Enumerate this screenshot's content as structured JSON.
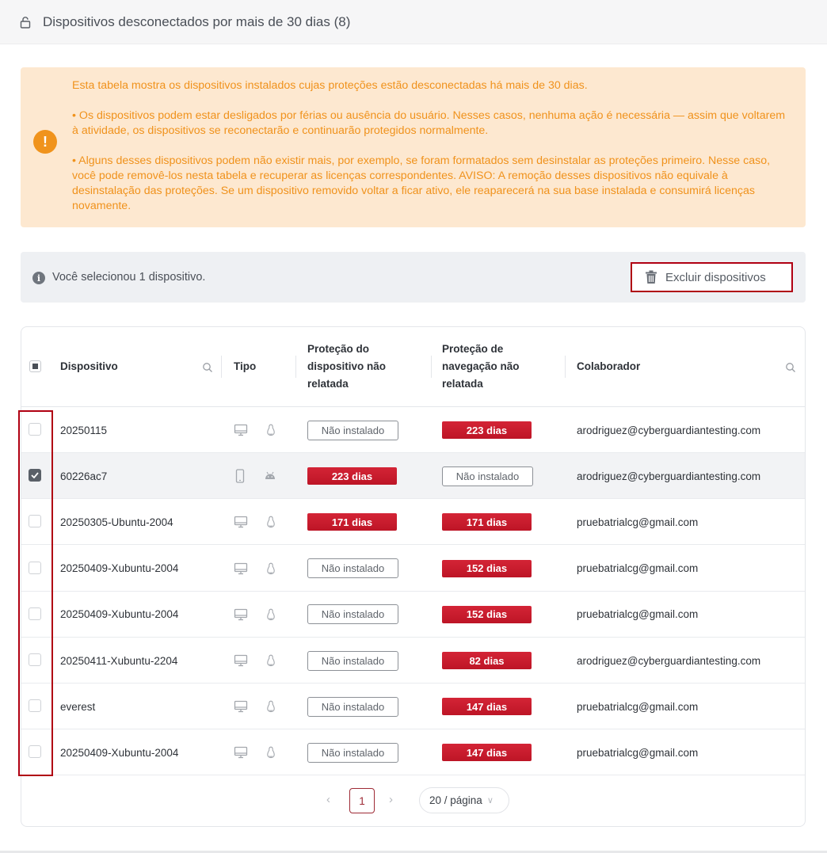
{
  "header": {
    "title": "Dispositivos desconectados por mais de 30 dias (8)",
    "icon": "lock-icon"
  },
  "warning": {
    "icon": "exclamation-icon",
    "color": "#f0921c",
    "paragraphs": [
      "Esta tabela mostra os dispositivos instalados cujas proteções estão desconectadas há mais de 30 dias.",
      "• Os dispositivos podem estar desligados por férias ou ausência do usuário. Nesses casos, nenhuma ação é necessária — assim que voltarem à atividade, os dispositivos se reconectarão e continuarão protegidos normalmente.",
      "• Alguns desses dispositivos podem não existir mais, por exemplo, se foram formatados sem desinstalar as proteções primeiro. Nesse caso, você pode removê-los nesta tabela e recuperar as licenças correspondentes. AVISO: A remoção desses dispositivos não equivale à desinstalação das proteções. Se um dispositivo removido voltar a ficar ativo, ele reaparecerá na sua base instalada e consumirá licenças novamente."
    ]
  },
  "selection": {
    "text": "Você selecionou 1 dispositivo.",
    "delete_label": "Excluir dispositivos"
  },
  "table": {
    "columns": {
      "device": "Dispositivo",
      "type": "Tipo",
      "device_protection": [
        "Proteção do",
        "dispositivo não",
        "relatada"
      ],
      "browsing_protection": [
        "Proteção de",
        "navegação não",
        "relatada"
      ],
      "collaborator": "Colaborador"
    },
    "rows": [
      {
        "device": "20250115",
        "type": "desktop",
        "os": "linux",
        "device_protection": "Não instalado",
        "device_protection_style": "outline",
        "browsing_protection": "223 dias",
        "browsing_protection_style": "red",
        "collaborator": "arodriguez@cyberguardiantesting.com",
        "checked": false
      },
      {
        "device": "60226ac7",
        "type": "mobile",
        "os": "android",
        "device_protection": "223 dias",
        "device_protection_style": "red",
        "browsing_protection": "Não instalado",
        "browsing_protection_style": "outline",
        "collaborator": "arodriguez@cyberguardiantesting.com",
        "checked": true
      },
      {
        "device": "20250305-Ubuntu-2004",
        "type": "desktop",
        "os": "linux",
        "device_protection": "171 dias",
        "device_protection_style": "red",
        "browsing_protection": "171 dias",
        "browsing_protection_style": "red",
        "collaborator": "pruebatrialcg@gmail.com",
        "checked": false
      },
      {
        "device": "20250409-Xubuntu-2004",
        "type": "desktop",
        "os": "linux",
        "device_protection": "Não instalado",
        "device_protection_style": "outline",
        "browsing_protection": "152 dias",
        "browsing_protection_style": "red",
        "collaborator": "pruebatrialcg@gmail.com",
        "checked": false
      },
      {
        "device": "20250409-Xubuntu-2004",
        "type": "desktop",
        "os": "linux",
        "device_protection": "Não instalado",
        "device_protection_style": "outline",
        "browsing_protection": "152 dias",
        "browsing_protection_style": "red",
        "collaborator": "pruebatrialcg@gmail.com",
        "checked": false
      },
      {
        "device": "20250411-Xubuntu-2204",
        "type": "desktop",
        "os": "linux",
        "device_protection": "Não instalado",
        "device_protection_style": "outline",
        "browsing_protection": "82 dias",
        "browsing_protection_style": "red",
        "collaborator": "arodriguez@cyberguardiantesting.com",
        "checked": false
      },
      {
        "device": "everest",
        "type": "desktop",
        "os": "linux",
        "device_protection": "Não instalado",
        "device_protection_style": "outline",
        "browsing_protection": "147 dias",
        "browsing_protection_style": "red",
        "collaborator": "pruebatrialcg@gmail.com",
        "checked": false
      },
      {
        "device": "20250409-Xubuntu-2004",
        "type": "desktop",
        "os": "linux",
        "device_protection": "Não instalado",
        "device_protection_style": "outline",
        "browsing_protection": "147 dias",
        "browsing_protection_style": "red",
        "collaborator": "pruebatrialcg@gmail.com",
        "checked": false
      }
    ]
  },
  "pagination": {
    "current_page": "1",
    "page_size": "20 / página"
  },
  "colors": {
    "accent_red": "#c9182b",
    "highlight_outline": "#b00012",
    "warning_bg": "#fde8d0"
  }
}
